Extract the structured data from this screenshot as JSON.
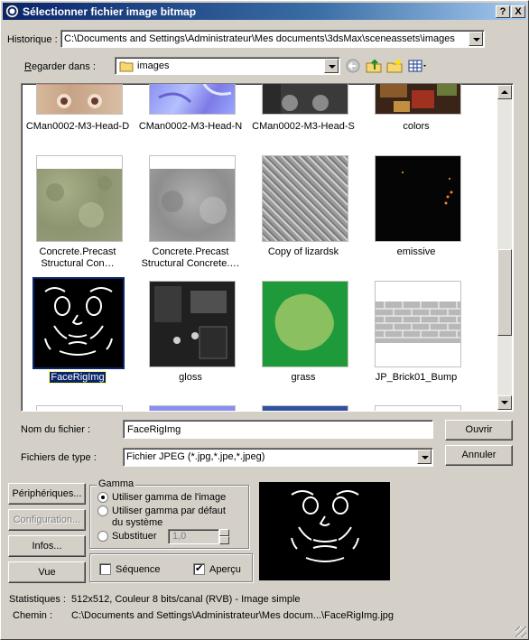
{
  "window": {
    "title": "Sélectionner fichier image bitmap",
    "help_button": "?",
    "close_button": "X"
  },
  "history": {
    "label": "Historique :",
    "value": "C:\\Documents and Settings\\Administrateur\\Mes documents\\3dsMax\\sceneassets\\images"
  },
  "lookin": {
    "label_underlined": "R",
    "label_rest": "egarder dans :",
    "value": "images"
  },
  "toolbar": {
    "icons": [
      "back-icon",
      "up-folder-icon",
      "new-folder-icon",
      "view-menu-icon"
    ]
  },
  "files": [
    {
      "name": "CMan0002-M3-Head-D",
      "selected": false
    },
    {
      "name": "CMan0002-M3-Head-N",
      "selected": false
    },
    {
      "name": "CMan0002-M3-Head-S",
      "selected": false
    },
    {
      "name": "colors",
      "selected": false
    },
    {
      "name": "Concrete.Precast Structural Con…",
      "selected": false
    },
    {
      "name": "Concrete.Precast Structural Concrete.…",
      "selected": false
    },
    {
      "name": "Copy of lizardsk",
      "selected": false
    },
    {
      "name": "emissive",
      "selected": false
    },
    {
      "name": "FaceRigImg",
      "selected": true
    },
    {
      "name": "gloss",
      "selected": false
    },
    {
      "name": "grass",
      "selected": false
    },
    {
      "name": "JP_Brick01_Bump",
      "selected": false
    }
  ],
  "filename": {
    "label": "Nom du fichier :",
    "value": "FaceRigImg"
  },
  "filetype": {
    "label": "Fichiers de type :",
    "value": "Fichier JPEG (*.jpg,*.jpe,*.jpeg)"
  },
  "buttons": {
    "open": "Ouvrir",
    "cancel": "Annuler",
    "devices": "Périphériques...",
    "setup": "Configuration...",
    "info": "Infos...",
    "view": "Vue"
  },
  "gamma": {
    "title": "Gamma",
    "use_image": "Utiliser gamma de l'image",
    "use_system_line1": "Utiliser gamma par défaut",
    "use_system_line2": "du système",
    "override": "Substituer",
    "override_value": "1,0"
  },
  "options": {
    "sequence": "Séquence",
    "preview": "Aperçu",
    "sequence_checked": false,
    "preview_checked": true
  },
  "stats": {
    "label": "Statistiques :",
    "value": "512x512, Couleur 8 bits/canal (RVB) - Image simple"
  },
  "path": {
    "label": "Chemin :",
    "value": "C:\\Documents and Settings\\Administrateur\\Mes docum...\\FaceRigImg.jpg"
  }
}
